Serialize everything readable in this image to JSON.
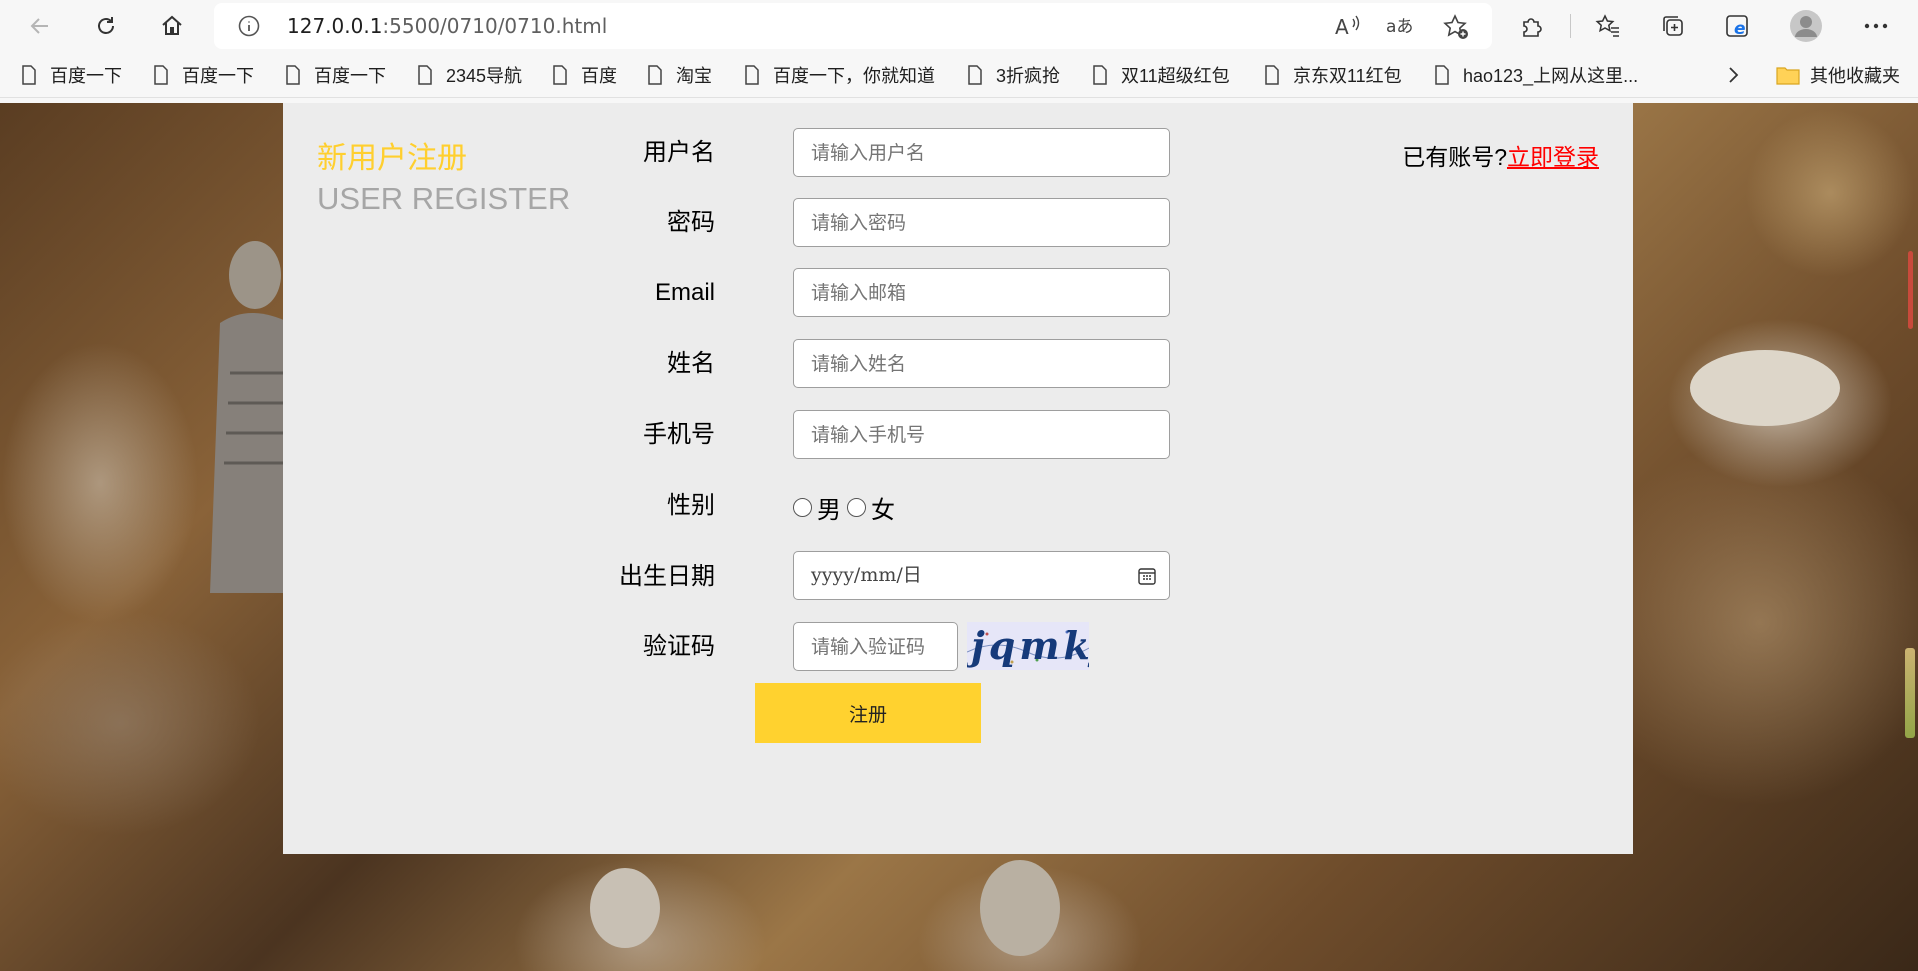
{
  "browser": {
    "url_host": "127.0.0.1",
    "url_path": ":5500/0710/0710.html",
    "icons": [
      "back-icon",
      "refresh-icon",
      "home-icon",
      "info-icon",
      "read-aloud-icon",
      "translate-icon",
      "add-favorite-icon",
      "extensions-icon",
      "favorites-icon",
      "collections-icon",
      "ie-mode-icon",
      "profile-icon",
      "more-icon"
    ]
  },
  "bookmarks": [
    {
      "label": "百度一下"
    },
    {
      "label": "百度一下"
    },
    {
      "label": "百度一下"
    },
    {
      "label": "2345导航"
    },
    {
      "label": "百度"
    },
    {
      "label": "淘宝"
    },
    {
      "label": "百度一下，你就知道"
    },
    {
      "label": "3折疯抢"
    },
    {
      "label": "双11超级红包"
    },
    {
      "label": "京东双11红包"
    },
    {
      "label": "hao123_上网从这里..."
    }
  ],
  "other_bookmarks": "其他收藏夹",
  "register": {
    "title_cn": "新用户注册",
    "title_en": "USER REGISTER",
    "have_account": "已有账号?",
    "login_link": "立即登录",
    "fields": [
      {
        "label": "用户名",
        "placeholder": "请输入用户名"
      },
      {
        "label": "密码",
        "placeholder": "请输入密码"
      },
      {
        "label": "Email",
        "placeholder": "请输入邮箱"
      },
      {
        "label": "姓名",
        "placeholder": "请输入姓名"
      },
      {
        "label": "手机号",
        "placeholder": "请输入手机号"
      }
    ],
    "gender_label": "性别",
    "gender_male": "男",
    "gender_female": "女",
    "birth_label": "出生日期",
    "birth_placeholder": "yyyy/mm/日",
    "captcha_label": "验证码",
    "captcha_placeholder": "请输入验证码",
    "captcha_text": "jqmkj",
    "submit_label": "注册"
  }
}
